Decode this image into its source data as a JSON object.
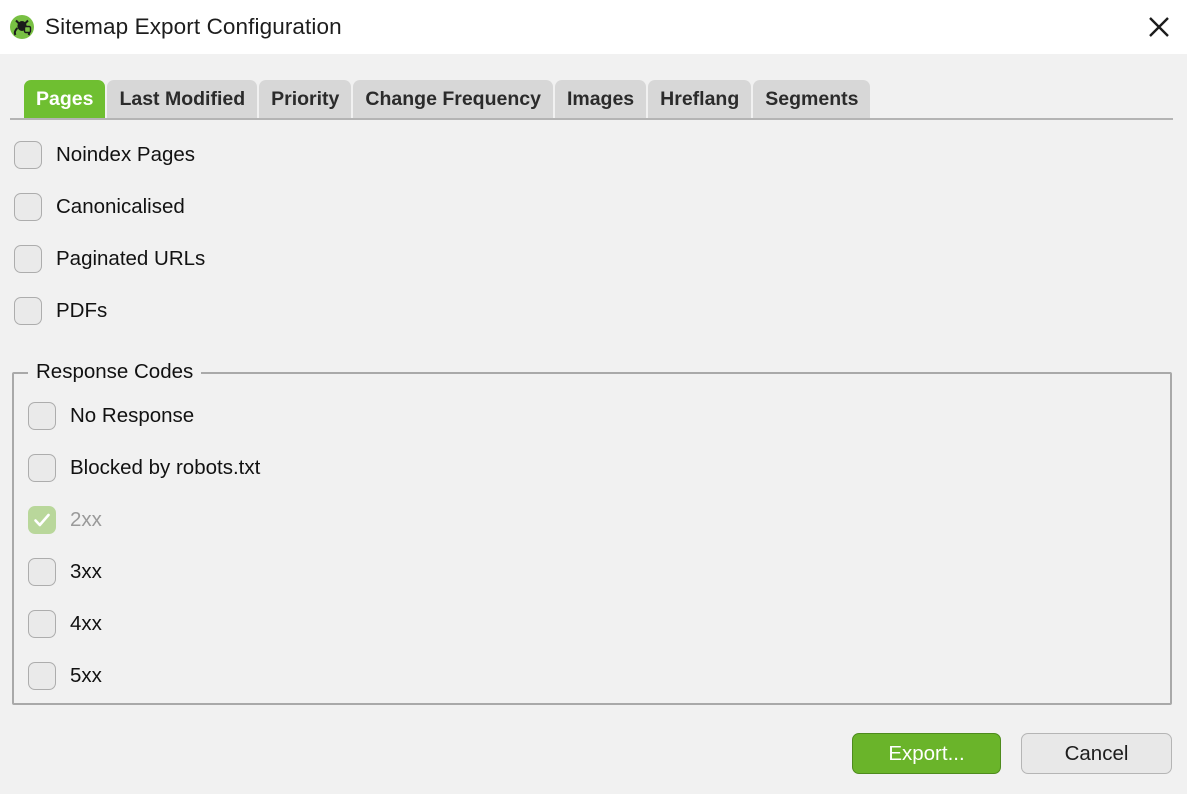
{
  "window": {
    "title": "Sitemap Export Configuration",
    "app_icon": "screaming-frog-logo",
    "close_icon": "close-icon"
  },
  "tabs": [
    {
      "label": "Pages",
      "active": true
    },
    {
      "label": "Last Modified",
      "active": false
    },
    {
      "label": "Priority",
      "active": false
    },
    {
      "label": "Change Frequency",
      "active": false
    },
    {
      "label": "Images",
      "active": false
    },
    {
      "label": "Hreflang",
      "active": false
    },
    {
      "label": "Segments",
      "active": false
    }
  ],
  "page_options": [
    {
      "label": "Noindex Pages",
      "checked": false,
      "disabled": false
    },
    {
      "label": "Canonicalised",
      "checked": false,
      "disabled": false
    },
    {
      "label": "Paginated URLs",
      "checked": false,
      "disabled": false
    },
    {
      "label": "PDFs",
      "checked": false,
      "disabled": false
    }
  ],
  "response_codes": {
    "title": "Response Codes",
    "options": [
      {
        "label": "No Response",
        "checked": false,
        "disabled": false
      },
      {
        "label": "Blocked by robots.txt",
        "checked": false,
        "disabled": false
      },
      {
        "label": "2xx",
        "checked": true,
        "disabled": true
      },
      {
        "label": "3xx",
        "checked": false,
        "disabled": false
      },
      {
        "label": "4xx",
        "checked": false,
        "disabled": false
      },
      {
        "label": "5xx",
        "checked": false,
        "disabled": false
      }
    ]
  },
  "footer": {
    "export_label": "Export...",
    "cancel_label": "Cancel"
  },
  "colors": {
    "accent_green": "#6fbf31",
    "export_green": "#6ab42a",
    "checked_disabled_green": "#b9d79b",
    "body_bg": "#f1f1f1",
    "titlebar_bg": "#ffffff",
    "tab_bg": "#d7d7d7"
  }
}
